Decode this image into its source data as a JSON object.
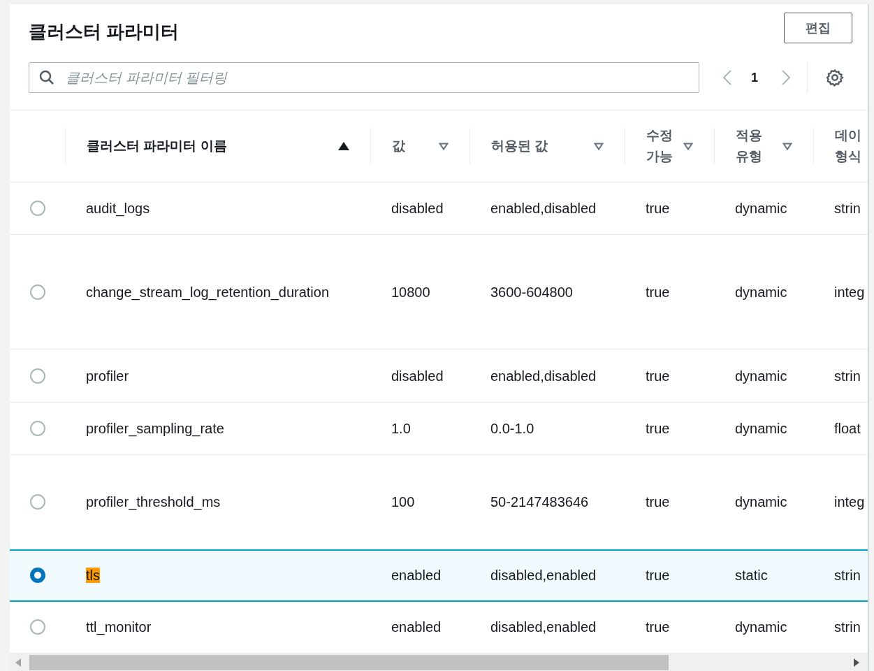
{
  "title": "클러스터 파라미터",
  "edit_button": "편집",
  "filter": {
    "placeholder": "클러스터 파라미터 필터링"
  },
  "pagination": {
    "page": "1"
  },
  "table": {
    "columns": [
      {
        "lines": [
          "클러스터 파라미터 이름"
        ],
        "sorted": true
      },
      {
        "lines": [
          "값"
        ],
        "sorted": false
      },
      {
        "lines": [
          "허용된 값"
        ],
        "sorted": false
      },
      {
        "lines": [
          "수정",
          "가능"
        ],
        "sorted": false
      },
      {
        "lines": [
          "적용",
          "유형"
        ],
        "sorted": false
      },
      {
        "lines": [
          "데이",
          "형식"
        ]
      }
    ],
    "rows": [
      {
        "selected": false,
        "highlighted": false,
        "cells": [
          "audit_logs",
          "disabled",
          "enabled,disabled",
          "true",
          "dynamic",
          "strin"
        ]
      },
      {
        "selected": false,
        "highlighted": false,
        "cells": [
          "change_stream_log_retention_duration",
          "10800",
          "3600-604800",
          "true",
          "dynamic",
          "integ"
        ]
      },
      {
        "selected": false,
        "highlighted": false,
        "cells": [
          "profiler",
          "disabled",
          "enabled,disabled",
          "true",
          "dynamic",
          "strin"
        ]
      },
      {
        "selected": false,
        "highlighted": false,
        "cells": [
          "profiler_sampling_rate",
          "1.0",
          "0.0-1.0",
          "true",
          "dynamic",
          "float"
        ]
      },
      {
        "selected": false,
        "highlighted": false,
        "cells": [
          "profiler_threshold_ms",
          "100",
          "50-2147483646",
          "true",
          "dynamic",
          "integ"
        ]
      },
      {
        "selected": true,
        "highlighted": true,
        "cells": [
          "tls",
          "enabled",
          "disabled,enabled",
          "true",
          "static",
          "strin"
        ]
      },
      {
        "selected": false,
        "highlighted": false,
        "cells": [
          "ttl_monitor",
          "enabled",
          "disabled,enabled",
          "true",
          "dynamic",
          "strin"
        ]
      }
    ]
  }
}
